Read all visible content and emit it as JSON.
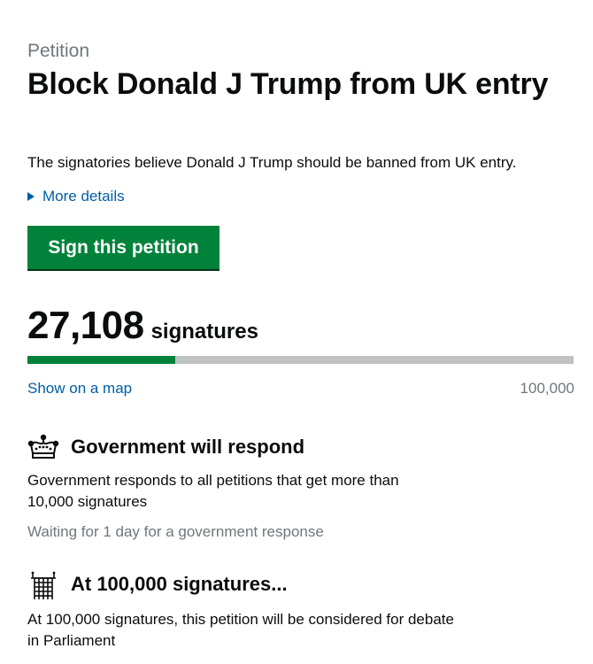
{
  "petition": {
    "caption": "Petition",
    "title": "Block Donald J Trump from UK entry",
    "summary": "The signatories believe Donald J Trump should be banned from UK entry.",
    "more_details_label": "More details",
    "sign_button_label": "Sign this petition"
  },
  "signatures": {
    "count": "27,108",
    "label": "signatures",
    "progress_fraction": 0.27108,
    "show_on_map_label": "Show on a map",
    "goal": "100,000"
  },
  "government_response": {
    "icon": "crown-icon",
    "heading": "Government will respond",
    "description_line1": "Government responds to all petitions that get more than",
    "description_line2": "10,000 signatures",
    "status": "Waiting for 1 day for a government response"
  },
  "debate": {
    "icon": "portcullis-icon",
    "heading": "At 100,000 signatures...",
    "description_line1": "At 100,000 signatures, this petition will be considered for debate",
    "description_line2": "in Parliament"
  },
  "colors": {
    "primary_green": "#00823b",
    "link_blue": "#005ea5",
    "muted_grey": "#6f777b",
    "progress_track": "#bfc1c3",
    "text": "#0b0c0c"
  }
}
